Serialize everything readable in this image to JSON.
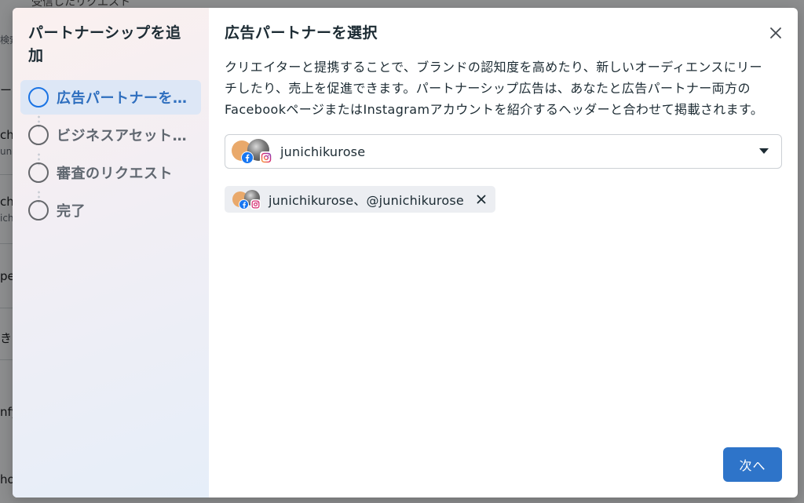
{
  "background": {
    "top_text": "受信したリクエスト",
    "fragments": [
      {
        "text": "検索",
        "small": true
      },
      {
        "text": "ー",
        "small": false
      },
      {
        "text": "chi",
        "small": false
      },
      {
        "text": "uni",
        "small": true
      },
      {
        "text": "chi",
        "small": false
      },
      {
        "text": "ich",
        "small": true
      },
      {
        "text": "pe_",
        "small": false
      },
      {
        "text": "き",
        "small": false
      },
      {
        "text": "nfy",
        "small": false
      },
      {
        "text": "ho",
        "small": false
      }
    ]
  },
  "stepper": {
    "title": "パートナーシップを追加",
    "steps": [
      {
        "label": "広告パートナーを選択"
      },
      {
        "label": "ビジネスアセットを選択"
      },
      {
        "label": "審査のリクエスト"
      },
      {
        "label": "完了"
      }
    ]
  },
  "main": {
    "title": "広告パートナーを選択",
    "description": "クリエイターと提携することで、ブランドの認知度を高めたり、新しいオーディエンスにリーチしたり、売上を促進できます。パートナーシップ広告は、あなたと広告パートナー両方のFacebookページまたはInstagramアカウントを紹介するヘッダーと合わせて掲載されます。",
    "select": {
      "value": "junichikurose"
    },
    "chip": {
      "label": "junichikurose、@junichikurose"
    },
    "next_button": "次へ"
  },
  "colors": {
    "primary": "#2e74c9",
    "active_step_bg": "#dde7f6",
    "facebook": "#1877f2"
  },
  "icons": {
    "close": "close-icon",
    "remove": "close-icon",
    "dropdown": "caret-down-icon",
    "facebook": "facebook-icon",
    "instagram": "instagram-icon"
  }
}
